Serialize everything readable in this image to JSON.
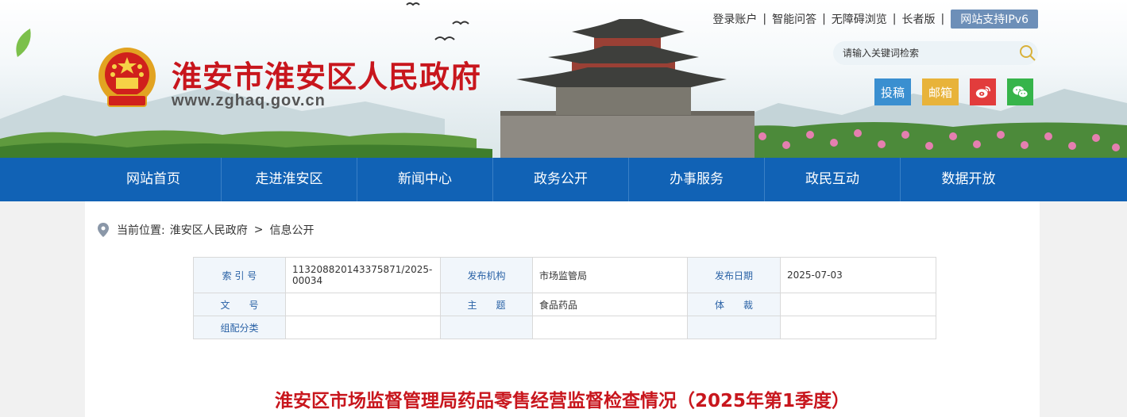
{
  "header": {
    "site_title": "淮安市淮安区人民政府",
    "site_url": "www.zghaq.gov.cn",
    "top_links": [
      "登录账户",
      "智能问答",
      "无障碍浏览",
      "长者版"
    ],
    "ipv6_label": "网站支持IPv6",
    "search_placeholder": "请输入关键词检索",
    "sns": {
      "tougao": "投稿",
      "youxiang": "邮箱"
    }
  },
  "nav": {
    "items": [
      "网站首页",
      "走进淮安区",
      "新闻中心",
      "政务公开",
      "办事服务",
      "政民互动",
      "数据开放"
    ]
  },
  "breadcrumb": {
    "prefix": "当前位置:",
    "items": [
      "淮安区人民政府",
      "信息公开"
    ],
    "separator": ">"
  },
  "meta": {
    "rows": [
      [
        {
          "label": "索 引 号",
          "value": "113208820143375871/2025-00034"
        },
        {
          "label": "发布机构",
          "value": "市场监管局"
        },
        {
          "label": "发布日期",
          "value": "2025-07-03"
        }
      ],
      [
        {
          "label": "文　　号",
          "value": ""
        },
        {
          "label": "主　　题",
          "value": "食品药品"
        },
        {
          "label": "体　　裁",
          "value": ""
        }
      ],
      [
        {
          "label": "组配分类",
          "value": ""
        },
        {
          "label": "",
          "value": ""
        },
        {
          "label": "",
          "value": ""
        }
      ]
    ]
  },
  "article": {
    "title": "淮安区市场监督管理局药品零售经营监督检查情况（2025年第1季度）"
  },
  "colors": {
    "brand_red": "#c8161d",
    "nav_blue": "#1162b5",
    "label_blue": "#2a62a6"
  }
}
